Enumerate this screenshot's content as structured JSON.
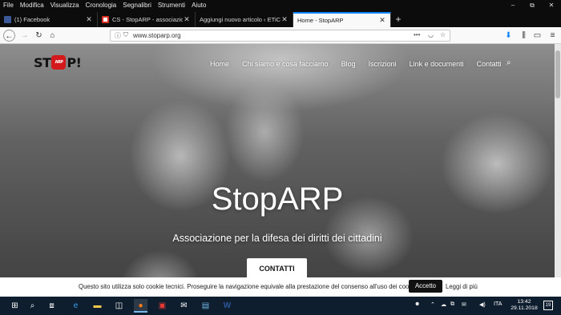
{
  "menubar": {
    "items": [
      "File",
      "Modifica",
      "Visualizza",
      "Cronologia",
      "Segnalibri",
      "Strumenti",
      "Aiuto"
    ],
    "underline": [
      "F",
      "M",
      "V",
      "C",
      "g",
      "S",
      "A"
    ]
  },
  "window_controls": [
    "–",
    "⧉",
    "✕"
  ],
  "tabs": [
    {
      "label": "(1) Facebook",
      "favicon_color": "#3b5998",
      "close": "✕"
    },
    {
      "label": "CS - StopARP - associazione.st",
      "favicon_color": "#d93025",
      "close": "✕"
    },
    {
      "label": "Aggiungi nuovo articolo ‹ ETiCinfor",
      "favicon_color": "#6b6b6b",
      "close": "✕"
    },
    {
      "label": "Home - StopARP",
      "favicon_color": "#f9f9fa",
      "close": "✕"
    }
  ],
  "new_tab": "+",
  "nav": {
    "back": "←",
    "forward": "→",
    "reload": "↻",
    "home": "⌂",
    "url": "www.stoparp.org",
    "info_icon": "ⓘ",
    "shield_icon": "⛉",
    "more": "•••",
    "pocket": "◡",
    "star": "☆",
    "download": "⬇",
    "library": "⫼",
    "sidebar": "▭",
    "menu": "≡"
  },
  "site": {
    "logo_left": "ST",
    "logo_badge": "ARP",
    "logo_right": "P!",
    "nav": [
      "Home",
      "Chi siamo e cosa facciamo",
      "Blog",
      "Iscrizioni",
      "Link e documenti",
      "Contatti"
    ],
    "search_icon": "⌕",
    "hero_title": "StopARP",
    "hero_subtitle": "Associazione per la difesa dei diritti dei cittadini",
    "hero_button": "CONTATTI"
  },
  "cookie": {
    "text": "Questo sito utilizza solo cookie tecnici. Proseguire la navigazione equivale alla prestazione del consenso all'uso dei cookie.",
    "accept": "Accetto",
    "more": "Leggi di più"
  },
  "taskbar": {
    "apps": [
      "⊞",
      "⌕",
      "⧈",
      "e",
      "▬",
      "◫",
      "●",
      "▣",
      "✉",
      "▤",
      "W"
    ],
    "tray": [
      "⌃",
      "☁",
      "⧉",
      "✉",
      "◀)"
    ],
    "language": "ITA",
    "time": "13:42",
    "date": "29.11.2018",
    "notifications": "19"
  },
  "colors": {
    "titlebar": "#0c0c0d",
    "accent": "#0a84ff",
    "logo_red": "#d3191c",
    "taskbar": "#0f1e2e"
  }
}
